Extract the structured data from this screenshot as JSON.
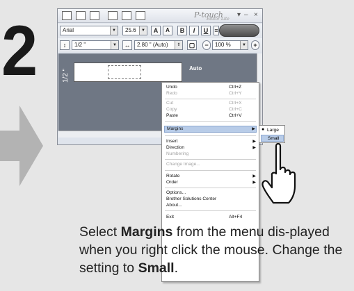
{
  "step": {
    "number": "2"
  },
  "app": {
    "logo_text": "P-touch",
    "logo_subtext": "Editor Lite",
    "window_controls": {
      "minimize": "–",
      "close": "×"
    }
  },
  "toolbar": {
    "font_name": "Arial",
    "font_size": "25.6",
    "grow_font": "A",
    "shrink_font": "A",
    "bold": "B",
    "italic": "I",
    "underline": "U",
    "tape_width": "1/2 \"",
    "label_length": "2.80 \" (Auto)",
    "zoom": "100 %"
  },
  "canvas": {
    "side_label": "1/2 \"",
    "auto_label": "Auto"
  },
  "context_menu": {
    "items": [
      {
        "label": "Undo",
        "shortcut": "Ctrl+Z",
        "disabled": false
      },
      {
        "label": "Redo",
        "shortcut": "Ctrl+Y",
        "disabled": true
      },
      {
        "label": "Cut",
        "shortcut": "Ctrl+X",
        "disabled": true
      },
      {
        "label": "Copy",
        "shortcut": "Ctrl+C",
        "disabled": true
      },
      {
        "label": "Paste",
        "shortcut": "Ctrl+V",
        "disabled": false
      },
      {
        "label": "Margins",
        "shortcut": "",
        "disabled": false,
        "highlighted": true,
        "submenu": true
      },
      {
        "label": "Insert",
        "shortcut": "",
        "disabled": false,
        "submenu": true
      },
      {
        "label": "Direction",
        "shortcut": "",
        "disabled": false,
        "submenu": true
      },
      {
        "label": "Numbering",
        "shortcut": "",
        "disabled": true
      },
      {
        "label": "Change Image...",
        "shortcut": "",
        "disabled": true
      },
      {
        "label": "Rotate",
        "shortcut": "",
        "disabled": false,
        "submenu": true
      },
      {
        "label": "Order",
        "shortcut": "",
        "disabled": false,
        "submenu": true
      },
      {
        "label": "Options...",
        "shortcut": "",
        "disabled": false
      },
      {
        "label": "Brother Solutions Center",
        "shortcut": "",
        "disabled": false
      },
      {
        "label": "About...",
        "shortcut": "",
        "disabled": false
      },
      {
        "label": "Exit",
        "shortcut": "Alt+F4",
        "disabled": false
      }
    ],
    "submenu_arrow": "▶"
  },
  "margins_submenu": {
    "items": [
      {
        "label": "Large",
        "checked": true
      },
      {
        "label": "Small",
        "highlighted": true
      }
    ],
    "check_mark": "●"
  },
  "instruction": {
    "part1": "Select ",
    "bold1": "Margins",
    "part2": " from the menu dis-played when you right click the mouse. Change the setting to ",
    "bold2": "Small",
    "part3": "."
  },
  "colors": {
    "canvas": "#6f7784",
    "highlight": "#b8cce8",
    "page_background": "#e6e6e6",
    "arrow": "#b3b3b3"
  }
}
